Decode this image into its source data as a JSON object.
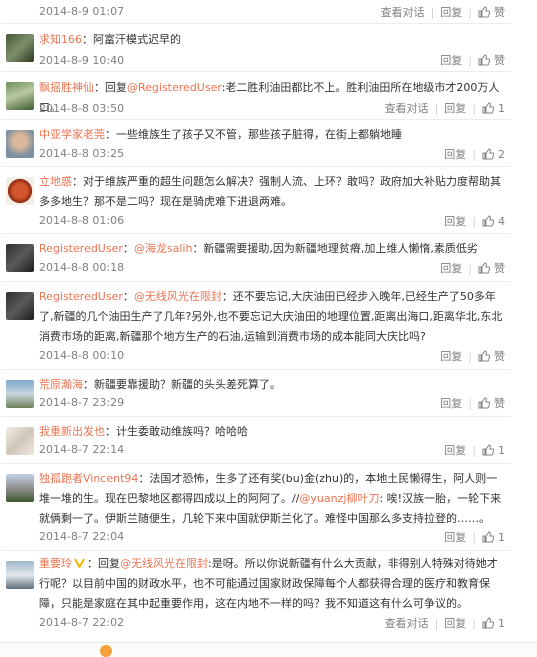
{
  "actions": {
    "reply": "回复",
    "dialog": "查看对话",
    "like": "赞"
  },
  "comments": [
    {
      "user": "",
      "text": "",
      "date": "2014-8-9 01:07",
      "dialog": true,
      "likes": "赞"
    },
    {
      "user": "求知166",
      "text": "：阿富汗模式迟早的",
      "date": "2014-8-9 10:40",
      "dialog": false,
      "likes": "赞"
    },
    {
      "user": "飘摇胜神仙",
      "prefix": "：回复",
      "mention": "@RegisteredUser",
      "text": ":老二胜利油田都比不上。胜利油田所在地级市才200万人口。",
      "date": "2014-8-8 03:50",
      "dialog": true,
      "likes": "1"
    },
    {
      "user": "中亚学家老莞",
      "text": "：一些维族生了孩子又不管，那些孩子脏得，在街上都躺地睡",
      "date": "2014-8-8 03:25",
      "dialog": false,
      "likes": "2"
    },
    {
      "user": "立地惑",
      "text": "：对于维族严重的超生问题怎么解决？强制人流、上环？敢吗？政府加大补贴力度帮助其多多地生？那不是二吗？现在是骑虎难下进退两难。",
      "date": "2014-8-8 01:06",
      "dialog": false,
      "likes": "4"
    },
    {
      "user": "RegisteredUser",
      "prefix": "：",
      "mention": "@海龙salih",
      "text": "：新疆需要援助,因为新疆地理贫瘠,加上维人懒惰,素质低劣",
      "date": "2014-8-8 00:18",
      "dialog": false,
      "likes": "赞"
    },
    {
      "user": "RegisteredUser",
      "prefix": "：",
      "mention": "@无线风光在限封",
      "text": "：还不要忘记,大庆油田已经步入晚年,已经生产了50多年了,新疆的几个油田生产了几年?另外,也不要忘记大庆油田的地理位置,距离出海口,距离华北,东北消费市场的距离,新疆那个地方生产的石油,运输到消费市场的成本能同大庆比吗?",
      "date": "2014-8-8 00:10",
      "dialog": false,
      "likes": "赞"
    },
    {
      "user": "荒原瀚海",
      "text": "：新疆要靠援助？新疆的头头差死算了。",
      "date": "2014-8-7 23:29",
      "dialog": false,
      "likes": "赞"
    },
    {
      "user": "我重新出发也",
      "text": "：计生委敢动维族吗？哈哈哈",
      "date": "2014-8-7 22:14",
      "dialog": false,
      "likes": "1"
    },
    {
      "user": "独孤跑者Vincent94",
      "text": "：法国才恐怖，生多了还有奖(bu)金(zhu)的，本地土民懒得生，阿人则一堆一堆的生。现在巴黎地区都得四成以上的阿阿了。//",
      "mention2": "@yuanzj柳叶刀",
      "text2": ": 唉!汉族一胎，一轮下来就俩剩一了。伊斯兰随便生，几轮下来中国就伊斯兰化了。难怪中国那么多支持拉登的……。",
      "date": "2014-8-7 22:04",
      "dialog": false,
      "likes": "1"
    },
    {
      "user": "重要玲",
      "badge": "V",
      "prefix": "：回复",
      "mention": "@无线风光在限封",
      "text": ":是呀。所以你说新疆有什么大贡献，非得别人特殊对待她才行呢？以目前中国的财政水平，也不可能通过国家财政保障每个人都获得合理的医疗和教育保障，只能是家庭在其中起重要作用，这在内地不一样的吗？我不知道这有什么可争议的。",
      "date": "2014-8-7 22:02",
      "dialog": true,
      "likes": "1"
    }
  ],
  "colors": {
    "link": "#eb7350",
    "meta": "#808080",
    "text": "#333333"
  },
  "icons": [
    "avatar",
    "thumb-up-icon",
    "verified-v-icon"
  ]
}
